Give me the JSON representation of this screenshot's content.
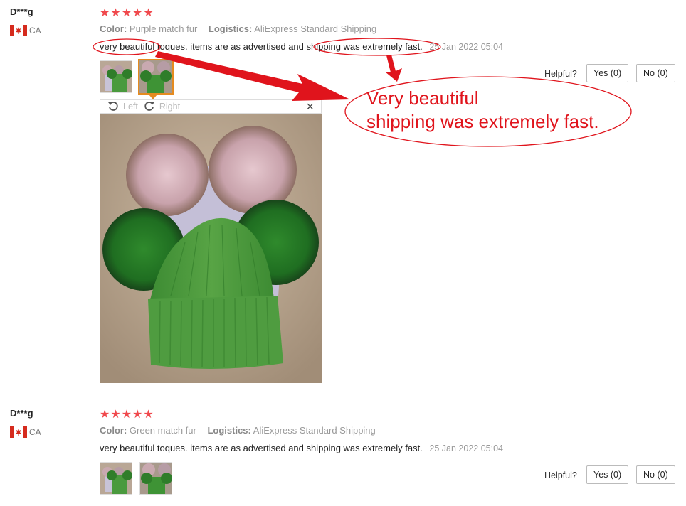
{
  "reviews": [
    {
      "user": "D***g",
      "country": "CA",
      "stars": "★★★★★",
      "color_label": "Color:",
      "color_value": "Purple match fur",
      "logistics_label": "Logistics:",
      "logistics_value": "AliExpress Standard Shipping",
      "text": "very beautiful toques. items are as advertised and shipping was extremely fast.",
      "date": "25 Jan 2022 05:04",
      "helpful_label": "Helpful?",
      "yes_label": "Yes (0)",
      "no_label": "No (0)"
    },
    {
      "user": "D***g",
      "country": "CA",
      "stars": "★★★★★",
      "color_label": "Color:",
      "color_value": "Green match fur",
      "logistics_label": "Logistics:",
      "logistics_value": "AliExpress Standard Shipping",
      "text": "very beautiful toques. items are as advertised and shipping was extremely fast.",
      "date": "25 Jan 2022 05:04",
      "helpful_label": "Helpful?",
      "yes_label": "Yes (0)",
      "no_label": "No (0)"
    }
  ],
  "viewer": {
    "left_label": "Left",
    "right_label": "Right",
    "close_glyph": "×"
  },
  "annotation": {
    "line1": "Very beautiful",
    "line2": "shipping was extremely fast."
  },
  "colors": {
    "star": "#f0494d",
    "annotation": "#e0141c",
    "selected_thumb": "#e58b20"
  }
}
